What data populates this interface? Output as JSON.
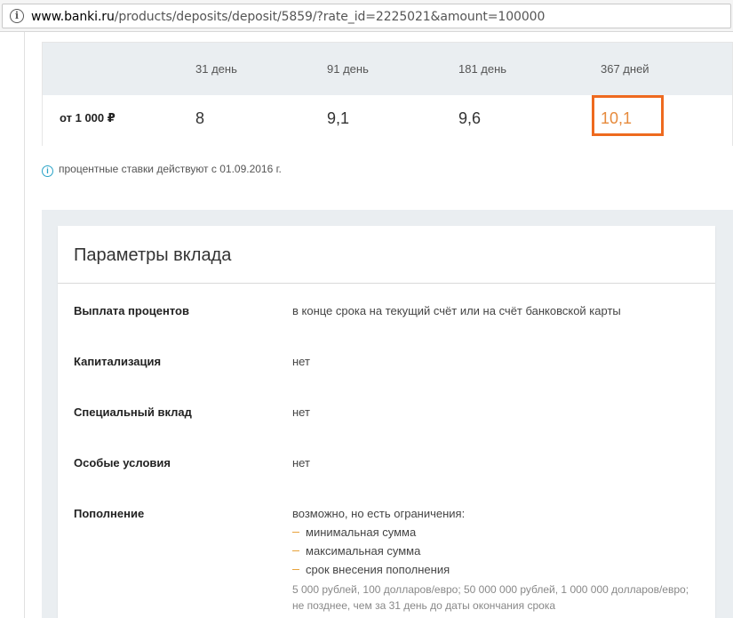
{
  "browser": {
    "info_glyph": "i",
    "url_host": "www.banki.ru",
    "url_path": "/products/deposits/deposit/5859/?rate_id=2225021&amount=100000"
  },
  "rates_table": {
    "terms": [
      "31 день",
      "91 день",
      "181 день",
      "367 дней"
    ],
    "row_label": "от 1 000 ₽",
    "rates": [
      "8",
      "9,1",
      "9,6",
      "10,1"
    ],
    "highlighted_index": 3
  },
  "note": {
    "icon": "info-circle-icon",
    "text": "процентные ставки действуют с 01.09.2016 г."
  },
  "params": {
    "title": "Параметры вклада",
    "rows": [
      {
        "label": "Выплата процентов",
        "value": "в конце срока на текущий счёт или на счёт банковской карты"
      },
      {
        "label": "Капитализация",
        "value": "нет"
      },
      {
        "label": "Специальный вклад",
        "value": "нет"
      },
      {
        "label": "Особые условия",
        "value": "нет"
      },
      {
        "label": "Пополнение",
        "value": "возможно, но есть ограничения:"
      }
    ],
    "replenish_bullets": [
      "минимальная сумма",
      "максимальная сумма",
      "срок внесения пополнения"
    ],
    "replenish_details": [
      "5 000 рублей, 100 долларов/евро; 50 000 000 рублей, 1 000 000 долларов/евро;",
      "не позднее, чем за 31 день до даты окончания срока"
    ]
  },
  "colors": {
    "accent_orange": "#e68a3c",
    "highlight_border": "#ee6a1f",
    "info_blue": "#2aa3c7",
    "table_header_bg": "#eaeef1"
  }
}
